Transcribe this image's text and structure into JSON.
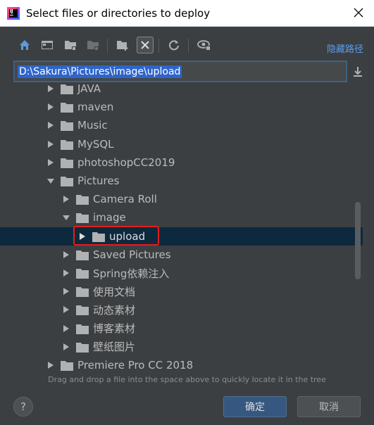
{
  "window": {
    "title": "Select files or directories to deploy"
  },
  "toolbar": {
    "icons": [
      "home-icon",
      "desktop-icon",
      "project-folder-icon",
      "module-folder-icon",
      "new-folder-icon",
      "delete-icon",
      "refresh-icon",
      "show-hidden-icon"
    ],
    "hide_path_label": "隐藏路径"
  },
  "path": {
    "value": "D:\\Sakura\\Pictures\\image\\upload"
  },
  "tree": {
    "items": [
      {
        "label": "JAVA",
        "level": 1,
        "expanded": false
      },
      {
        "label": "maven",
        "level": 1,
        "expanded": false
      },
      {
        "label": "Music",
        "level": 1,
        "expanded": false
      },
      {
        "label": "MySQL",
        "level": 1,
        "expanded": false
      },
      {
        "label": "photoshopCC2019",
        "level": 1,
        "expanded": false
      },
      {
        "label": "Pictures",
        "level": 1,
        "expanded": true
      },
      {
        "label": "Camera Roll",
        "level": 2,
        "expanded": false
      },
      {
        "label": "image",
        "level": 2,
        "expanded": true
      },
      {
        "label": "upload",
        "level": 3,
        "expanded": false,
        "selected": true
      },
      {
        "label": "Saved Pictures",
        "level": 2,
        "expanded": false
      },
      {
        "label": "Spring依赖注入",
        "level": 2,
        "expanded": false
      },
      {
        "label": "使用文档",
        "level": 2,
        "expanded": false
      },
      {
        "label": "动态素材",
        "level": 2,
        "expanded": false
      },
      {
        "label": "博客素材",
        "level": 2,
        "expanded": false
      },
      {
        "label": "壁纸图片",
        "level": 2,
        "expanded": false
      },
      {
        "label": "Premiere Pro CC 2018",
        "level": 1,
        "expanded": false
      }
    ]
  },
  "hint": "Drag and drop a file into the space above to quickly locate it in the tree",
  "buttons": {
    "help": "?",
    "ok": "确定",
    "cancel": "取消"
  },
  "colors": {
    "background": "#3c3f41",
    "selection": "#0d293e",
    "accent": "#589df6",
    "highlight": "#e51c1c"
  }
}
